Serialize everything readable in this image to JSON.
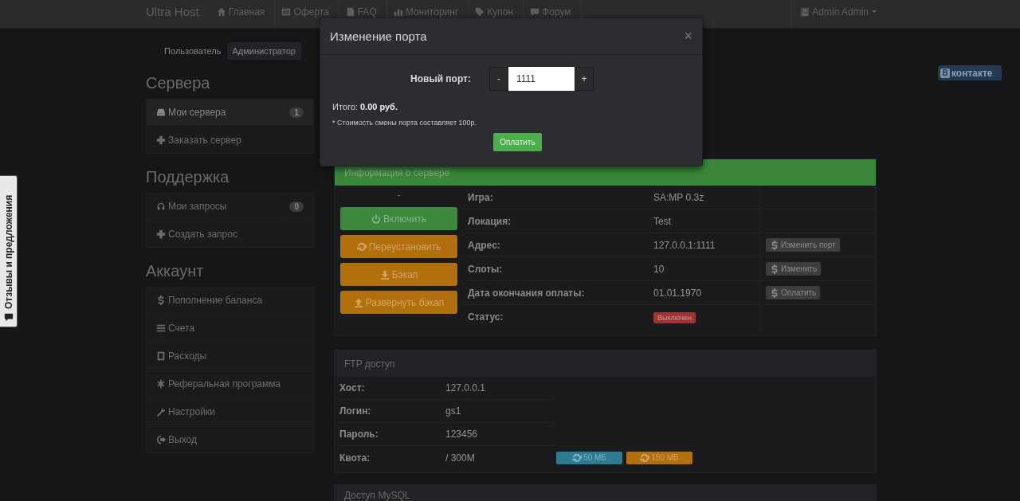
{
  "navbar": {
    "brand": "Ultra Host",
    "items": [
      {
        "label": "Главная"
      },
      {
        "label": "Оферта"
      },
      {
        "label": "FAQ"
      },
      {
        "label": "Мониторинг"
      },
      {
        "label": "Купон"
      },
      {
        "label": "Форум"
      }
    ],
    "user": "Admin Admin"
  },
  "role_tabs": [
    {
      "label": "Пользователь",
      "selected": false
    },
    {
      "label": "Администратор",
      "selected": true
    }
  ],
  "sidebar": [
    {
      "title": "Сервера",
      "items": [
        {
          "label": "Мои сервера",
          "badge": "1",
          "selected": true
        },
        {
          "label": "Заказать сервер",
          "selected": false
        }
      ]
    },
    {
      "title": "Поддержка",
      "items": [
        {
          "label": "Мои запросы",
          "badge": "0",
          "selected": false
        },
        {
          "label": "Создать запрос",
          "selected": false
        }
      ]
    },
    {
      "title": "Аккаунт",
      "items": [
        {
          "label": "Пополнение баланса",
          "selected": false
        },
        {
          "label": "Счета",
          "selected": false
        },
        {
          "label": "Расходы",
          "selected": false
        },
        {
          "label": "Реферальная программа",
          "selected": false
        },
        {
          "label": "Настройки",
          "selected": false
        },
        {
          "label": "Выход",
          "selected": false
        }
      ]
    }
  ],
  "vk_button": {
    "logo_letter": "В",
    "label": "контакте"
  },
  "feedback_tab": {
    "label": "Отзывы и предложения"
  },
  "modal": {
    "title": "Изменение порта",
    "close": "×",
    "field_label": "Новый порт:",
    "minus": "-",
    "value": "1111",
    "plus": "+",
    "total": "Итого: **0.00 руб.**",
    "note": "* Стоимость смены порта составляет 100р.",
    "pay_button": "Оплатить"
  },
  "server_panel": {
    "title": "Информация о сервере",
    "marker": "-",
    "buttons": [
      {
        "label": "Включить",
        "kind": "success"
      },
      {
        "label": "Переустановить",
        "kind": "warning"
      },
      {
        "label": "Бэкап",
        "kind": "warning"
      },
      {
        "label": "Развернуть бэкап",
        "kind": "warning"
      }
    ],
    "rows": [
      {
        "label": "Игра:",
        "value": "SA:MP 0.3z"
      },
      {
        "label": "Локация:",
        "value": "Test"
      },
      {
        "label": "Адрес:",
        "value": "127.0.0.1:1111",
        "action": "Изменить порт"
      },
      {
        "label": "Слоты:",
        "value": "10",
        "action": "Изменить"
      },
      {
        "label": "Дата окончания оплаты:",
        "value": "01.01.1970",
        "action": "Оплатить"
      }
    ],
    "status": {
      "label": "Статус:",
      "value": "Выключен",
      "kind": "danger"
    }
  },
  "ftp_panel": {
    "title": "FTP доступ",
    "rows": [
      {
        "label": "Хост:",
        "value": "127.0.0.1"
      },
      {
        "label": "Логин:",
        "value": "gs1"
      },
      {
        "label": "Пароль:",
        "value": "123456"
      },
      {
        "label": "Квота:",
        "value": "/ 300M"
      }
    ],
    "quota_buttons": [
      {
        "label": "50 МБ",
        "kind": "info"
      },
      {
        "label": "150 МБ",
        "kind": "warning"
      }
    ]
  },
  "mysql_panel": {
    "title": "Доступ MySQL"
  }
}
